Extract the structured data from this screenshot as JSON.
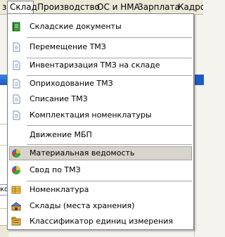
{
  "menubar": {
    "items": [
      {
        "label": "з"
      },
      {
        "label": "Склад"
      },
      {
        "label": "Производство"
      },
      {
        "label": "ОС и НМА"
      },
      {
        "label": "Зарплата"
      },
      {
        "label": "Кадровый"
      }
    ]
  },
  "background": {
    "field_text": "ко"
  },
  "dropdown": {
    "items": [
      {
        "label": "Складские документы",
        "icon": "journal-book-icon"
      },
      {
        "label": "Перемещение ТМЗ",
        "icon": "document-icon"
      },
      {
        "label": "Инвентаризация ТМЗ на складе",
        "icon": "document-icon"
      },
      {
        "label": "Оприходование ТМЗ",
        "icon": "document-icon"
      },
      {
        "label": "Списание ТМЗ",
        "icon": "document-icon"
      },
      {
        "label": "Комплектация номенклатуры",
        "icon": "document-icon"
      },
      {
        "label": "Движение МБП",
        "icon": "none"
      },
      {
        "label": "Материальная ведомость",
        "icon": "report-icon"
      },
      {
        "label": "Свод по ТМЗ",
        "icon": "report-icon"
      },
      {
        "label": "Номенклатура",
        "icon": "catalog-icon"
      },
      {
        "label": "Склады (места хранения)",
        "icon": "warehouse-icon"
      },
      {
        "label": "Классификатор единиц измерения",
        "icon": "classifier-icon"
      }
    ],
    "highlighted_index": 7
  }
}
